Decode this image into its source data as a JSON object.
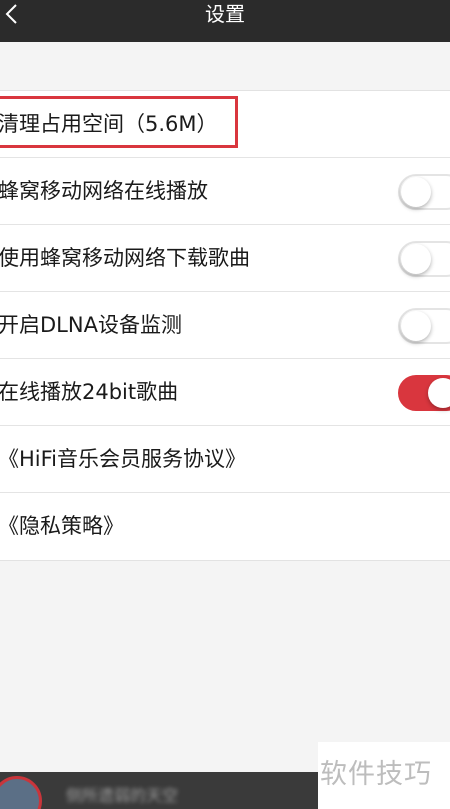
{
  "header": {
    "title": "设置",
    "back_icon": "chevron-left-icon"
  },
  "settings": {
    "items": [
      {
        "label": "清理占用空间（5.6M）"
      },
      {
        "label": "蜂窝移动网络在线播放",
        "toggle": "off"
      },
      {
        "label": "使用蜂窝移动网络下载歌曲",
        "toggle": "off"
      },
      {
        "label": "开启DLNA设备监测",
        "toggle": "off"
      },
      {
        "label": "在线播放24bit歌曲",
        "toggle": "on"
      },
      {
        "label": "《HiFi音乐会员服务协议》"
      },
      {
        "label": "《隐私策略》"
      }
    ]
  },
  "player": {
    "track": "侧所遗弱的天空"
  },
  "watermark": "软件技巧",
  "colors": {
    "navbar": "#2b2b2b",
    "accent": "#d9363e",
    "background": "#f4f4f4"
  }
}
